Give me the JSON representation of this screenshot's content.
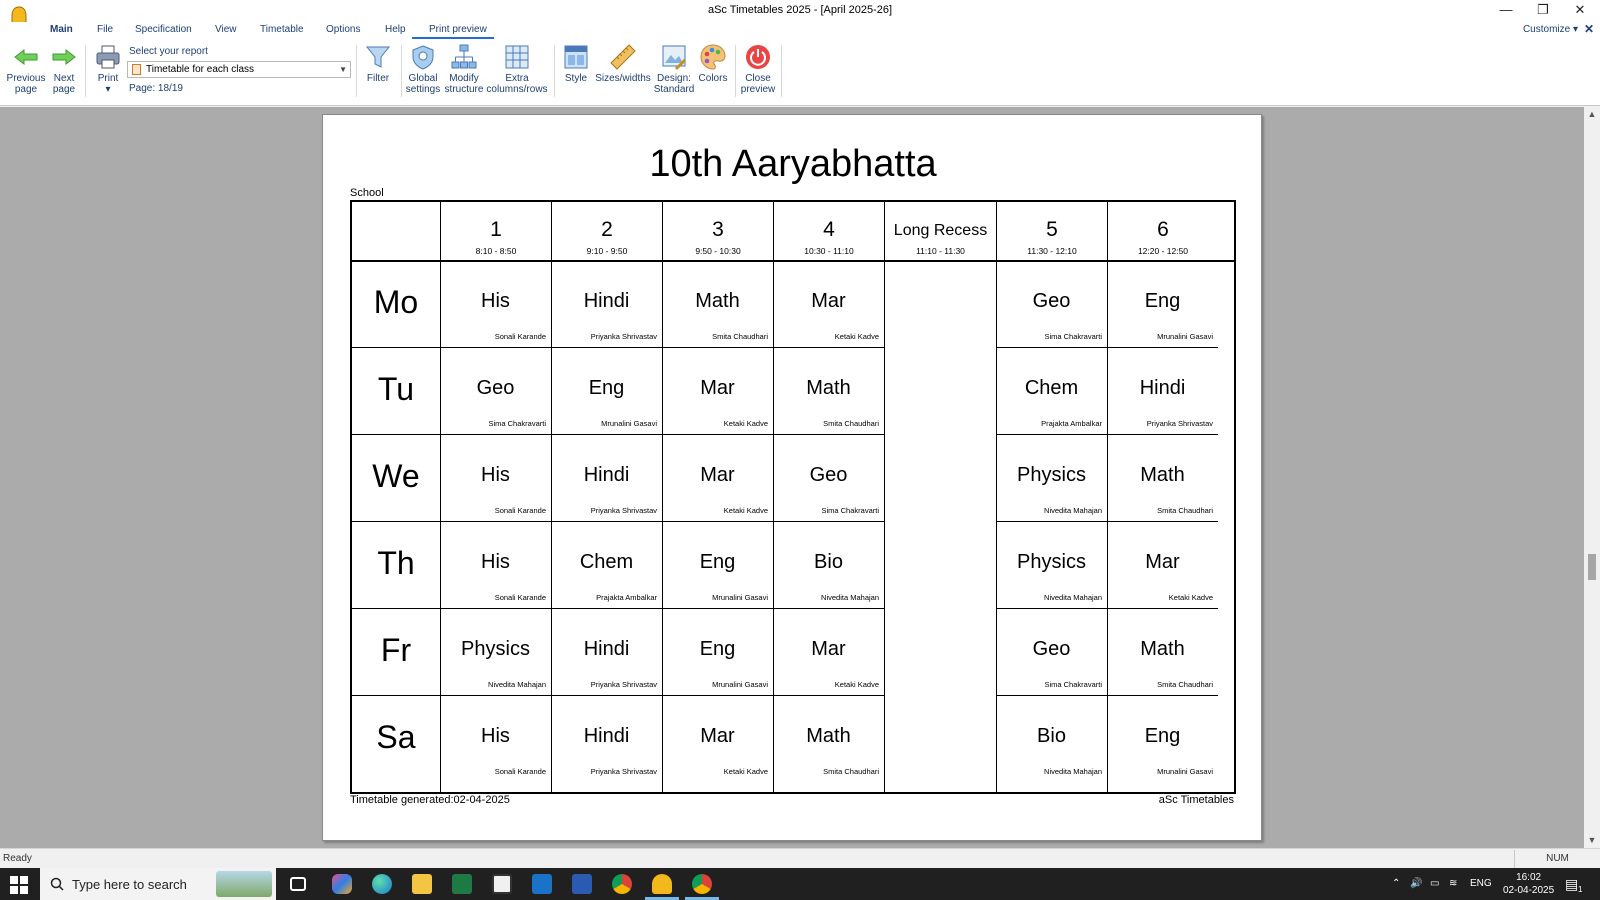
{
  "window": {
    "title": "aSc Timetables 2025  - [April 2025-26]",
    "minimize": "—",
    "restore": "❐",
    "close": "✕"
  },
  "menu": {
    "tabs": [
      "Main",
      "File",
      "Specification",
      "View",
      "Timetable",
      "Options",
      "Help",
      "Print preview"
    ],
    "customize": "Customize ▾",
    "customize_close": "✕"
  },
  "ribbon": {
    "previous_page": [
      "Previous",
      "page"
    ],
    "next_page": [
      "Next",
      "page"
    ],
    "print": "Print",
    "print_arrow": "▾",
    "select_report_label": "Select your report",
    "report_value": "Timetable for each class",
    "page_info": "Page: 18/19",
    "filter": "Filter",
    "global_settings": [
      "Global",
      "settings"
    ],
    "modify_structure": [
      "Modify",
      "structure"
    ],
    "extra_columns": [
      "Extra",
      "columns/rows"
    ],
    "style": "Style",
    "sizes_widths": "Sizes/widths",
    "design": [
      "Design:",
      "Standard"
    ],
    "colors": "Colors",
    "close_preview": [
      "Close",
      "preview"
    ]
  },
  "page": {
    "title": "10th Aaryabhatta",
    "school_label": "School",
    "footer_left": "Timetable generated:02-04-2025",
    "footer_right": "aSc Timetables",
    "periods": [
      {
        "name": "1",
        "time": "8:10 - 8:50"
      },
      {
        "name": "2",
        "time": "9:10 - 9:50"
      },
      {
        "name": "3",
        "time": "9:50 - 10:30"
      },
      {
        "name": "4",
        "time": "10:30 - 11:10"
      },
      {
        "name": "Long Recess",
        "time": "11:10 - 11:30"
      },
      {
        "name": "5",
        "time": "11:30 - 12:10"
      },
      {
        "name": "6",
        "time": "12:20 - 12:50"
      }
    ],
    "days": [
      {
        "day": "Mo",
        "cells": [
          {
            "subject": "His",
            "teacher": "Sonali Karande"
          },
          {
            "subject": "Hindi",
            "teacher": "Priyanka Shrivastav"
          },
          {
            "subject": "Math",
            "teacher": "Smita Chaudhari"
          },
          {
            "subject": "Mar",
            "teacher": "Ketaki Kadve"
          },
          null,
          {
            "subject": "Geo",
            "teacher": "Sima Chakravarti"
          },
          {
            "subject": "Eng",
            "teacher": "Mrunalini Gasavi"
          }
        ]
      },
      {
        "day": "Tu",
        "cells": [
          {
            "subject": "Geo",
            "teacher": "Sima Chakravarti"
          },
          {
            "subject": "Eng",
            "teacher": "Mrunalini Gasavi"
          },
          {
            "subject": "Mar",
            "teacher": "Ketaki Kadve"
          },
          {
            "subject": "Math",
            "teacher": "Smita Chaudhari"
          },
          null,
          {
            "subject": "Chem",
            "teacher": "Prajakta Ambalkar"
          },
          {
            "subject": "Hindi",
            "teacher": "Priyanka Shrivastav"
          }
        ]
      },
      {
        "day": "We",
        "cells": [
          {
            "subject": "His",
            "teacher": "Sonali Karande"
          },
          {
            "subject": "Hindi",
            "teacher": "Priyanka Shrivastav"
          },
          {
            "subject": "Mar",
            "teacher": "Ketaki Kadve"
          },
          {
            "subject": "Geo",
            "teacher": "Sima Chakravarti"
          },
          null,
          {
            "subject": "Physics",
            "teacher": "Nivedita Mahajan"
          },
          {
            "subject": "Math",
            "teacher": "Smita Chaudhari"
          }
        ]
      },
      {
        "day": "Th",
        "cells": [
          {
            "subject": "His",
            "teacher": "Sonali Karande"
          },
          {
            "subject": "Chem",
            "teacher": "Prajakta Ambalkar"
          },
          {
            "subject": "Eng",
            "teacher": "Mrunalini Gasavi"
          },
          {
            "subject": "Bio",
            "teacher": "Nivedita Mahajan"
          },
          null,
          {
            "subject": "Physics",
            "teacher": "Nivedita Mahajan"
          },
          {
            "subject": "Mar",
            "teacher": "Ketaki Kadve"
          }
        ]
      },
      {
        "day": "Fr",
        "cells": [
          {
            "subject": "Physics",
            "teacher": "Nivedita Mahajan"
          },
          {
            "subject": "Hindi",
            "teacher": "Priyanka Shrivastav"
          },
          {
            "subject": "Eng",
            "teacher": "Mrunalini Gasavi"
          },
          {
            "subject": "Mar",
            "teacher": "Ketaki Kadve"
          },
          null,
          {
            "subject": "Geo",
            "teacher": "Sima Chakravarti"
          },
          {
            "subject": "Math",
            "teacher": "Smita Chaudhari"
          }
        ]
      },
      {
        "day": "Sa",
        "cells": [
          {
            "subject": "His",
            "teacher": "Sonali Karande"
          },
          {
            "subject": "Hindi",
            "teacher": "Priyanka Shrivastav"
          },
          {
            "subject": "Mar",
            "teacher": "Ketaki Kadve"
          },
          {
            "subject": "Math",
            "teacher": "Smita Chaudhari"
          },
          null,
          {
            "subject": "Bio",
            "teacher": "Nivedita Mahajan"
          },
          {
            "subject": "Eng",
            "teacher": "Mrunalini Gasavi"
          }
        ]
      }
    ]
  },
  "status": {
    "text": "Ready",
    "num": "NUM"
  },
  "taskbar": {
    "search_placeholder": "Type here to search",
    "lang": "ENG",
    "time": "16:02",
    "date": "02-04-2025",
    "notification_count": "1"
  },
  "colors": {
    "accent": "#1e6fd0",
    "menu_text": "#1e3f74",
    "workspace": "#ababab"
  }
}
